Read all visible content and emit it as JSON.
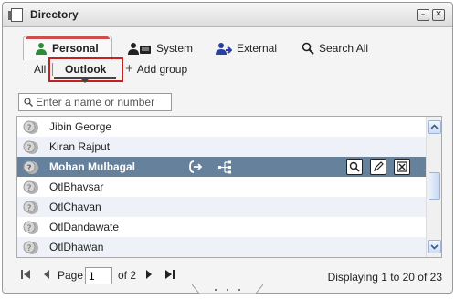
{
  "window": {
    "title": "Directory",
    "minimize_label": "–",
    "close_label": "✕"
  },
  "tabs": [
    {
      "label": "Personal",
      "icon": "person-icon",
      "active": true
    },
    {
      "label": "System",
      "icon": "people-icon"
    },
    {
      "label": "External",
      "icon": "external-person-icon"
    },
    {
      "label": "Search All",
      "icon": "search-icon"
    }
  ],
  "subtabs": {
    "all": "All",
    "outlook": "Outlook",
    "add_group": "Add group"
  },
  "search": {
    "placeholder": "Enter a name or number"
  },
  "contacts": [
    {
      "name": "Jibin George"
    },
    {
      "name": "Kiran Rajput"
    },
    {
      "name": "Mohan Mulbagal",
      "selected": true
    },
    {
      "name": "OtlBhavsar"
    },
    {
      "name": "OtlChavan"
    },
    {
      "name": "OtlDandawate"
    },
    {
      "name": "OtlDhawan"
    }
  ],
  "row_actions": [
    "transfer-icon",
    "tree-icon",
    "view-icon",
    "edit-icon",
    "delete-icon"
  ],
  "pager": {
    "page_label": "Page",
    "page_value": "1",
    "of_label": "of 2",
    "displaying": "Displaying 1 to 20 of 23"
  },
  "colors": {
    "selected_row": "#66819c",
    "alt_row": "#eef2f8",
    "active_tab_accent": "#d34b4b",
    "highlight_frame": "#c42121"
  }
}
